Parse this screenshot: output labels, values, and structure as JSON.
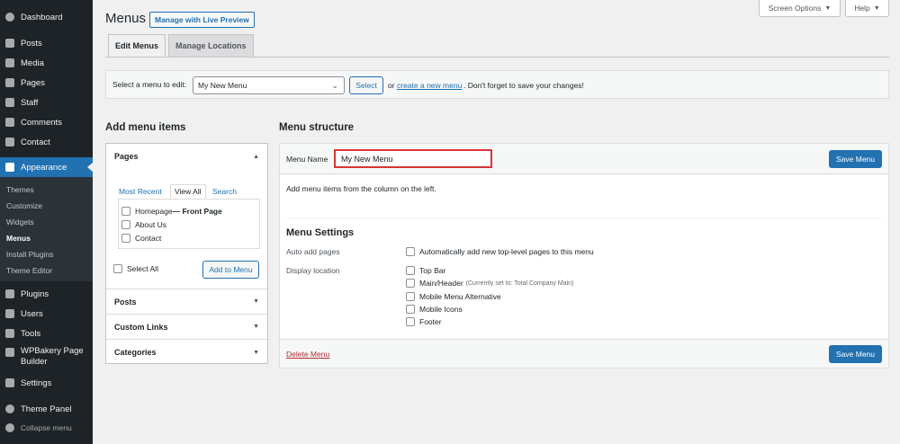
{
  "sidebar": {
    "items": [
      {
        "label": "Dashboard",
        "icon": "dashboard-icon"
      },
      {
        "label": "Posts",
        "icon": "pin-icon"
      },
      {
        "label": "Media",
        "icon": "media-icon"
      },
      {
        "label": "Pages",
        "icon": "pages-icon"
      },
      {
        "label": "Staff",
        "icon": "staff-icon"
      },
      {
        "label": "Comments",
        "icon": "comments-icon"
      },
      {
        "label": "Contact",
        "icon": "contact-icon"
      },
      {
        "label": "Appearance",
        "icon": "brush-icon"
      },
      {
        "label": "Plugins",
        "icon": "plugin-icon"
      },
      {
        "label": "Users",
        "icon": "users-icon"
      },
      {
        "label": "Tools",
        "icon": "wrench-icon"
      },
      {
        "label": "WPBakery Page Builder",
        "icon": "wpbakery-icon"
      },
      {
        "label": "Settings",
        "icon": "settings-icon"
      },
      {
        "label": "Theme Panel",
        "icon": "theme-panel-icon"
      },
      {
        "label": "Collapse menu",
        "icon": "collapse-icon"
      }
    ],
    "appearance_sub": [
      "Themes",
      "Customize",
      "Widgets",
      "Menus",
      "Install Plugins",
      "Theme Editor"
    ]
  },
  "top_buttons": {
    "screen_options": "Screen Options",
    "help": "Help"
  },
  "header": {
    "title": "Menus",
    "live_preview": "Manage with Live Preview"
  },
  "tabs": [
    {
      "label": "Edit Menus"
    },
    {
      "label": "Manage Locations"
    }
  ],
  "select_bar": {
    "label": "Select a menu to edit:",
    "selected": "My New Menu",
    "select_button": "Select",
    "or_text": "or",
    "create_link": "create a new menu",
    "reminder": ". Don't forget to save your changes!"
  },
  "add_items": {
    "heading": "Add menu items",
    "pages": {
      "title": "Pages",
      "tabs": [
        "Most Recent",
        "View All",
        "Search"
      ],
      "list": [
        {
          "label": "Homepage",
          "suffix": " — Front Page"
        },
        {
          "label": "About Us",
          "suffix": ""
        },
        {
          "label": "Contact",
          "suffix": ""
        }
      ],
      "select_all": "Select All",
      "add_button": "Add to Menu"
    },
    "sections": [
      "Posts",
      "Custom Links",
      "Categories"
    ]
  },
  "structure": {
    "heading": "Menu structure",
    "menu_name_label": "Menu Name",
    "menu_name_value": "My New Menu",
    "save_button": "Save Menu",
    "instructions": "Add menu items from the column on the left.",
    "settings_title": "Menu Settings",
    "auto_add_label": "Auto add pages",
    "auto_add_option": "Automatically add new top-level pages to this menu",
    "display_location_label": "Display location",
    "locations": [
      {
        "label": "Top Bar",
        "note": ""
      },
      {
        "label": "Main/Header",
        "note": "(Currently set to: Total Company Main)"
      },
      {
        "label": "Mobile Menu Alternative",
        "note": ""
      },
      {
        "label": "Mobile Icons",
        "note": ""
      },
      {
        "label": "Footer",
        "note": ""
      }
    ],
    "delete_link": "Delete Menu"
  },
  "colors": {
    "sidebar_bg": "#1d2327",
    "accent": "#2271b1",
    "highlight_border": "#d63638"
  }
}
